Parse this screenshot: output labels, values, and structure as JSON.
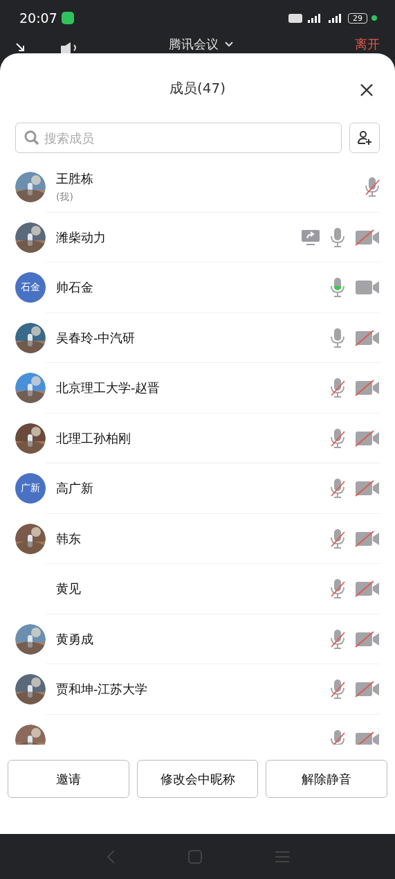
{
  "status_bar": {
    "time": "20:07",
    "battery": "29"
  },
  "meeting_bar": {
    "title": "腾讯会议",
    "leave": "离开"
  },
  "sheet": {
    "title": "成员(47)",
    "search": {
      "placeholder": "搜索成员"
    }
  },
  "members": [
    {
      "name": "王胜栋",
      "note": "(我)",
      "mic_muted": true,
      "speaking": false,
      "sharing": false
    },
    {
      "name": "潍柴动力",
      "mic_muted": false,
      "speaking": false,
      "camera_off": true,
      "sharing": true
    },
    {
      "name": "帅石金",
      "avatar": {
        "kind": "initials",
        "text": "石金"
      },
      "mic_muted": false,
      "speaking": true,
      "camera_off": false,
      "sharing": false
    },
    {
      "name": "吴春玲-中汽研",
      "mic_muted": false,
      "speaking": false,
      "camera_off": true,
      "sharing": false
    },
    {
      "name": "北京理工大学-赵晋",
      "mic_muted": true,
      "speaking": false,
      "camera_off": true,
      "sharing": false
    },
    {
      "name": "北理工孙柏刚",
      "mic_muted": true,
      "speaking": false,
      "camera_off": true,
      "sharing": false
    },
    {
      "name": "高广新",
      "avatar": {
        "kind": "initials",
        "text": "广新"
      },
      "mic_muted": true,
      "speaking": false,
      "camera_off": true,
      "sharing": false
    },
    {
      "name": "韩东",
      "mic_muted": true,
      "speaking": false,
      "camera_off": true,
      "sharing": false
    },
    {
      "name": "黄见",
      "avatar": {
        "kind": "none"
      },
      "mic_muted": true,
      "speaking": false,
      "camera_off": true,
      "sharing": false
    },
    {
      "name": "黄勇成",
      "mic_muted": true,
      "speaking": false,
      "camera_off": true,
      "sharing": false
    },
    {
      "name": "贾和坤-江苏大学",
      "mic_muted": true,
      "speaking": false,
      "camera_off": true,
      "sharing": false
    },
    {
      "mic_muted": true,
      "speaking": false,
      "camera_off": true,
      "sharing": false
    }
  ],
  "buttons": [
    "邀请",
    "修改会中昵称",
    "解除静音"
  ]
}
